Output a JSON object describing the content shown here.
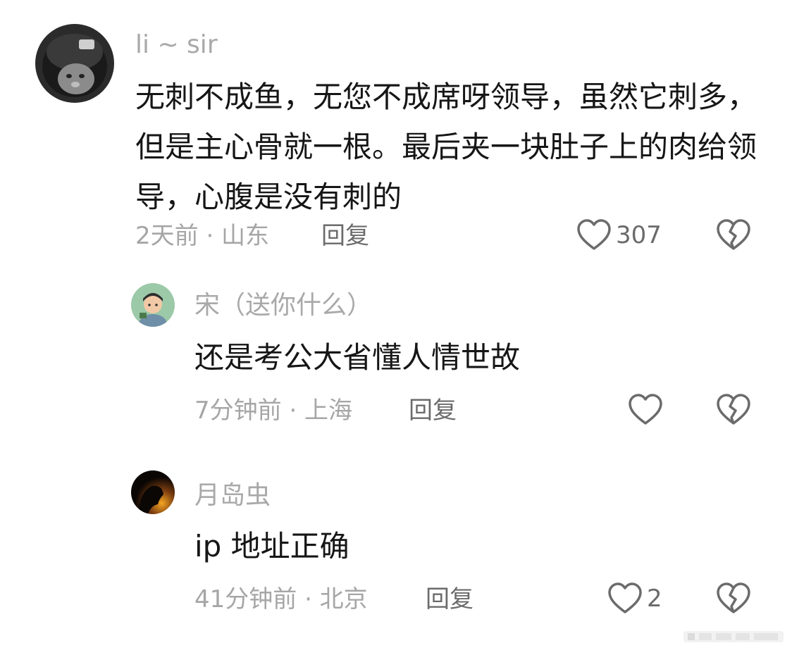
{
  "comments": [
    {
      "username": "li ~ sir",
      "text": "无刺不成鱼，无您不成席呀领导，虽然它刺多，但是主心骨就一根。最后夹一块肚子上的肉给领导，心腹是没有刺的",
      "meta": "2天前 · 山东",
      "reply_label": "回复",
      "like_count": "307",
      "avatar": "cat-helmet-avatar"
    },
    {
      "username": "宋（送你什么）",
      "text": "还是考公大省懂人情世故",
      "meta": "7分钟前 · 上海",
      "reply_label": "回复",
      "like_count": "",
      "avatar": "cartoon-person-avatar"
    },
    {
      "username": "月岛虫",
      "text": "ip 地址正确",
      "meta": "41分钟前 · 北京",
      "reply_label": "回复",
      "like_count": "2",
      "avatar": "sunset-silhouette-avatar"
    }
  ],
  "colors": {
    "username": "#a9a9a9",
    "text": "#161616",
    "meta": "#a6a6a6",
    "reply": "#6b6b6b",
    "icon": "#6b6b6b"
  }
}
